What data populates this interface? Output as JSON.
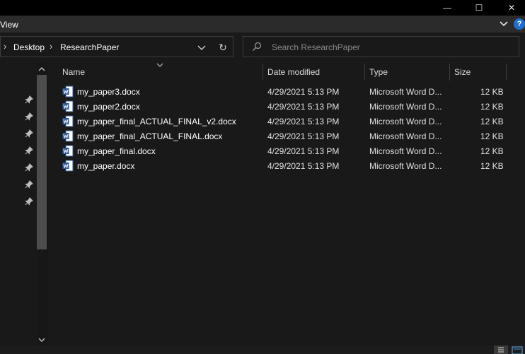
{
  "window": {
    "minimize_glyph": "—",
    "maximize_glyph": "☐",
    "close_glyph": "✕"
  },
  "ribbon": {
    "view_tab": "View",
    "help_glyph": "?"
  },
  "address": {
    "crumbs": [
      "Desktop",
      "ResearchPaper"
    ],
    "separator": "›",
    "refresh_glyph": "↻"
  },
  "search": {
    "placeholder": "Search ResearchPaper"
  },
  "columns": {
    "name": "Name",
    "date": "Date modified",
    "type": "Type",
    "size": "Size"
  },
  "files": [
    {
      "name": "my_paper3.docx",
      "date": "4/29/2021 5:13 PM",
      "type": "Microsoft Word D...",
      "size": "12 KB"
    },
    {
      "name": "my_paper2.docx",
      "date": "4/29/2021 5:13 PM",
      "type": "Microsoft Word D...",
      "size": "12 KB"
    },
    {
      "name": "my_paper_final_ACTUAL_FINAL_v2.docx",
      "date": "4/29/2021 5:13 PM",
      "type": "Microsoft Word D...",
      "size": "12 KB"
    },
    {
      "name": "my_paper_final_ACTUAL_FINAL.docx",
      "date": "4/29/2021 5:13 PM",
      "type": "Microsoft Word D...",
      "size": "12 KB"
    },
    {
      "name": "my_paper_final.docx",
      "date": "4/29/2021 5:13 PM",
      "type": "Microsoft Word D...",
      "size": "12 KB"
    },
    {
      "name": "my_paper.docx",
      "date": "4/29/2021 5:13 PM",
      "type": "Microsoft Word D...",
      "size": "12 KB"
    }
  ],
  "colors": {
    "background": "#191919",
    "titlebar": "#000000",
    "word_blue": "#2b579a",
    "help_blue": "#1f6fd1"
  }
}
